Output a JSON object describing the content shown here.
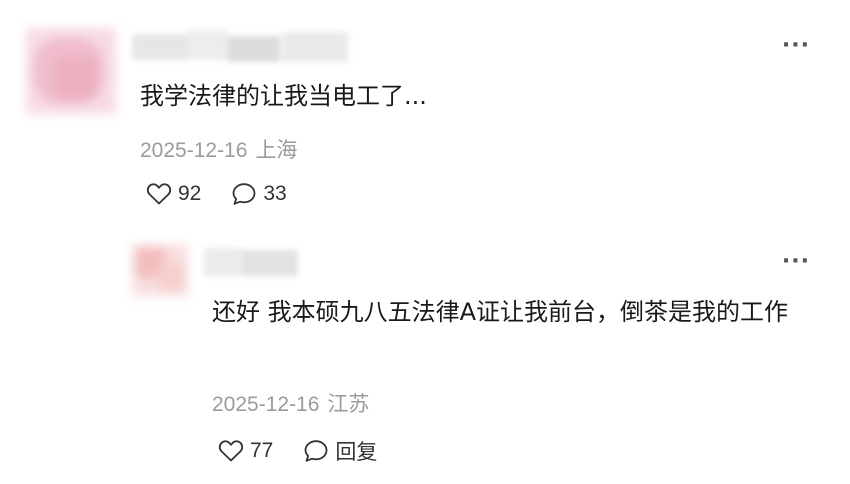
{
  "comments": [
    {
      "text": "我学法律的让我当电工了...",
      "date": "2025-12-16",
      "location": "上海",
      "likes": "92",
      "replies": "33",
      "more": "···",
      "avatar_color": "#f2c4d0"
    },
    {
      "text": "还好 我本硕九八五法律A证让我前台，倒茶是我的工作",
      "date": "2025-12-16",
      "location": "江苏",
      "likes": "77",
      "reply_label": "回复",
      "more": "···",
      "avatar_color": "#f5c9c9"
    }
  ],
  "icons": {
    "like": "heart-outline-icon",
    "comment": "speech-bubble-icon",
    "more": "more-dots-icon"
  },
  "colors": {
    "text": "#1a1a1a",
    "meta": "#9b9b9b",
    "icon": "#333333"
  }
}
